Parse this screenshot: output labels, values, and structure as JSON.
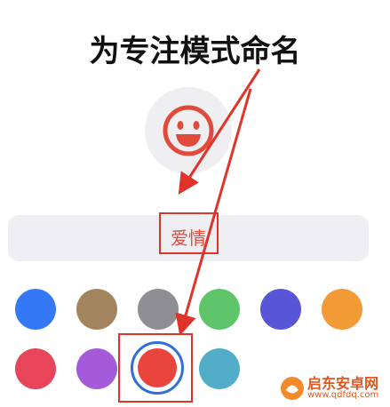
{
  "title": "为专注模式命名",
  "name_field": {
    "value": "爱情"
  },
  "icon": "smiley-face-icon",
  "colors": {
    "row1": [
      "#3478f6",
      "#a2845e",
      "#8e8e93",
      "#5fc56b",
      "#5856d6",
      "#f29a36"
    ],
    "row2": [
      "#e8445a",
      "#a55bd9",
      "#e8453c",
      "#52adc8"
    ],
    "selected": "#e8453c",
    "annotation": "#e0342a"
  },
  "watermark": {
    "line1": "启东安卓网",
    "line2": "www.qdfdq.com"
  }
}
